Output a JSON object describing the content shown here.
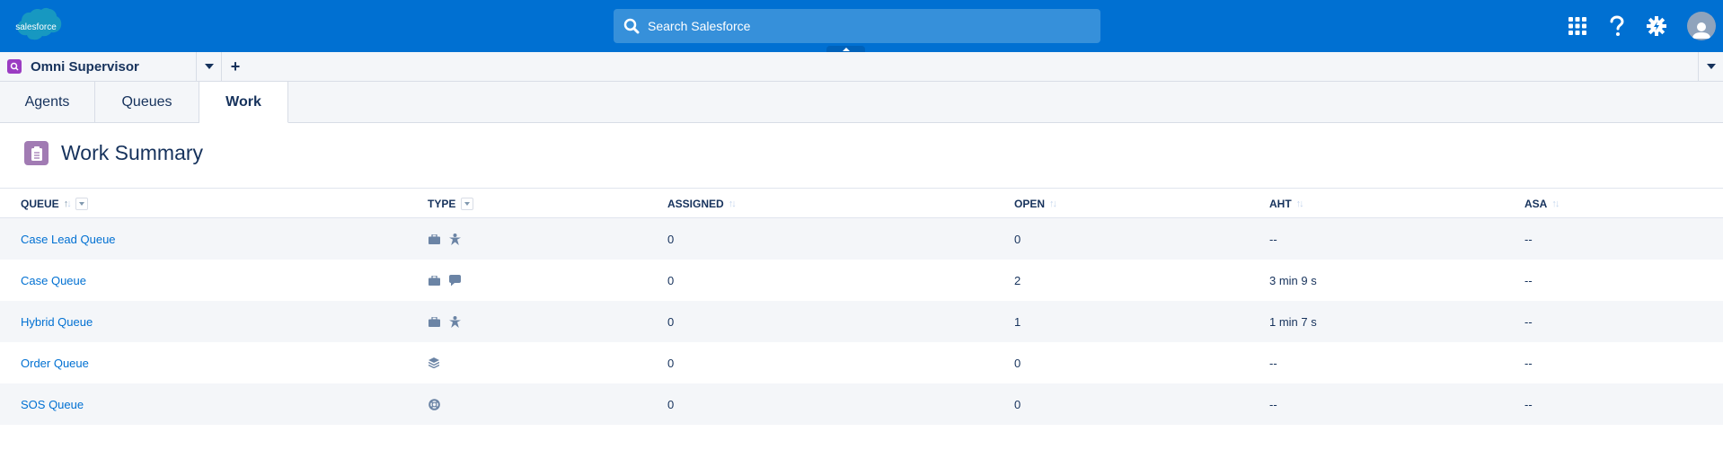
{
  "header": {
    "brand": "salesforce",
    "search_placeholder": "Search Salesforce",
    "icons": [
      "app-launcher-icon",
      "help-icon",
      "setup-gear-icon",
      "user-avatar-icon"
    ]
  },
  "console_nav": {
    "app_title": "Omni Supervisor",
    "app_icon": "omni-supervisor-icon",
    "add_tab_label": "+"
  },
  "subtabs": [
    {
      "label": "Agents",
      "active": false
    },
    {
      "label": "Queues",
      "active": false
    },
    {
      "label": "Work",
      "active": true
    }
  ],
  "page": {
    "title": "Work Summary",
    "icon": "clipboard-icon"
  },
  "table": {
    "columns": [
      {
        "key": "queue",
        "label": "QUEUE",
        "sortable": true,
        "sorted": "asc",
        "filter": true
      },
      {
        "key": "type",
        "label": "TYPE",
        "sortable": false,
        "filter": true
      },
      {
        "key": "assigned",
        "label": "ASSIGNED",
        "sortable": true
      },
      {
        "key": "open",
        "label": "OPEN",
        "sortable": true
      },
      {
        "key": "aht",
        "label": "AHT",
        "sortable": true
      },
      {
        "key": "asa",
        "label": "ASA",
        "sortable": true
      }
    ],
    "rows": [
      {
        "queue": "Case Lead Queue",
        "types": [
          "case-briefcase-icon",
          "lead-person-icon"
        ],
        "assigned": "0",
        "open": "0",
        "aht": "--",
        "asa": "--"
      },
      {
        "queue": "Case Queue",
        "types": [
          "case-briefcase-icon",
          "chat-bubble-icon"
        ],
        "assigned": "0",
        "open": "2",
        "aht": "3 min 9 s",
        "asa": "--"
      },
      {
        "queue": "Hybrid Queue",
        "types": [
          "case-briefcase-icon",
          "lead-person-icon"
        ],
        "assigned": "0",
        "open": "1",
        "aht": "1 min 7 s",
        "asa": "--"
      },
      {
        "queue": "Order Queue",
        "types": [
          "order-stack-icon"
        ],
        "assigned": "0",
        "open": "0",
        "aht": "--",
        "asa": "--"
      },
      {
        "queue": "SOS Queue",
        "types": [
          "sos-lifebuoy-icon"
        ],
        "assigned": "0",
        "open": "0",
        "aht": "--",
        "asa": "--"
      }
    ]
  },
  "colors": {
    "brand_blue": "#0070D2",
    "link": "#0070D2",
    "text": "#16325C",
    "app_icon": "#9B3CC2",
    "title_icon": "#A17BB3",
    "type_icon": "#6B84A5"
  }
}
